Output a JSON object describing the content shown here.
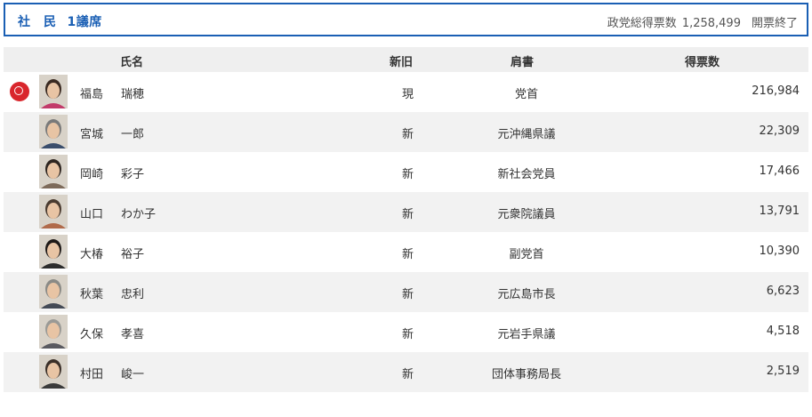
{
  "header": {
    "party": "社　民",
    "seats": "1議席",
    "total_label": "政党総得票数",
    "total_votes": "1,258,499",
    "status": "開票終了"
  },
  "columns": {
    "name": "氏名",
    "status": "新旧",
    "title": "肩書",
    "votes": "得票数"
  },
  "candidates": [
    {
      "family": "福島",
      "given": "瑞穂",
      "status": "現",
      "title": "党首",
      "votes": "216,984",
      "elected": true
    },
    {
      "family": "宮城",
      "given": "一郎",
      "status": "新",
      "title": "元沖縄県議",
      "votes": "22,309",
      "elected": false
    },
    {
      "family": "岡崎",
      "given": "彩子",
      "status": "新",
      "title": "新社会党員",
      "votes": "17,466",
      "elected": false
    },
    {
      "family": "山口",
      "given": "わか子",
      "status": "新",
      "title": "元衆院議員",
      "votes": "13,791",
      "elected": false
    },
    {
      "family": "大椿",
      "given": "裕子",
      "status": "新",
      "title": "副党首",
      "votes": "10,390",
      "elected": false
    },
    {
      "family": "秋葉",
      "given": "忠利",
      "status": "新",
      "title": "元広島市長",
      "votes": "6,623",
      "elected": false
    },
    {
      "family": "久保",
      "given": "孝喜",
      "status": "新",
      "title": "元岩手県議",
      "votes": "4,518",
      "elected": false
    },
    {
      "family": "村田",
      "given": "峻一",
      "status": "新",
      "title": "団体事務局長",
      "votes": "2,519",
      "elected": false
    }
  ],
  "colors": {
    "accent": "#1a5fb4",
    "elected_mark": "#d9262c",
    "header_bg": "#efefef",
    "alt_row": "#f2f2f2"
  }
}
